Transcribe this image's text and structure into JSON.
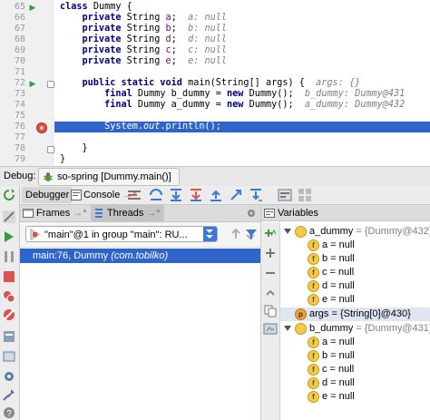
{
  "editor": {
    "lines": [
      {
        "num": "65",
        "parts": [
          {
            "t": "class ",
            "c": "kw"
          },
          {
            "t": "Dummy {",
            "c": ""
          }
        ]
      },
      {
        "num": "66",
        "parts": [
          {
            "t": "    private ",
            "c": "kw"
          },
          {
            "t": "String ",
            "c": ""
          },
          {
            "t": "a",
            "c": "fld"
          },
          {
            "t": ";  ",
            "c": ""
          },
          {
            "t": "a: null",
            "c": "hint"
          }
        ]
      },
      {
        "num": "67",
        "parts": [
          {
            "t": "    private ",
            "c": "kw"
          },
          {
            "t": "String ",
            "c": ""
          },
          {
            "t": "b",
            "c": "fld"
          },
          {
            "t": ";  ",
            "c": ""
          },
          {
            "t": "b: null",
            "c": "hint"
          }
        ]
      },
      {
        "num": "68",
        "parts": [
          {
            "t": "    private ",
            "c": "kw"
          },
          {
            "t": "String ",
            "c": ""
          },
          {
            "t": "d",
            "c": "fld"
          },
          {
            "t": ";  ",
            "c": ""
          },
          {
            "t": "d: null",
            "c": "hint"
          }
        ]
      },
      {
        "num": "69",
        "parts": [
          {
            "t": "    private ",
            "c": "kw"
          },
          {
            "t": "String ",
            "c": ""
          },
          {
            "t": "c",
            "c": "fld"
          },
          {
            "t": ";  ",
            "c": ""
          },
          {
            "t": "c: null",
            "c": "hint"
          }
        ]
      },
      {
        "num": "70",
        "parts": [
          {
            "t": "    private ",
            "c": "kw"
          },
          {
            "t": "String ",
            "c": ""
          },
          {
            "t": "e",
            "c": "fld"
          },
          {
            "t": ";  ",
            "c": ""
          },
          {
            "t": "e: null",
            "c": "hint"
          }
        ]
      },
      {
        "num": "71",
        "parts": []
      },
      {
        "num": "72",
        "parts": [
          {
            "t": "    public static void ",
            "c": "kw"
          },
          {
            "t": "main(String[] args) {  ",
            "c": ""
          },
          {
            "t": "args: {}",
            "c": "hint"
          }
        ]
      },
      {
        "num": "73",
        "parts": [
          {
            "t": "        final ",
            "c": "kw"
          },
          {
            "t": "Dummy b_dummy = ",
            "c": ""
          },
          {
            "t": "new ",
            "c": "kw"
          },
          {
            "t": "Dummy();  ",
            "c": ""
          },
          {
            "t": "b_dummy: Dummy@431",
            "c": "hint"
          }
        ]
      },
      {
        "num": "74",
        "parts": [
          {
            "t": "        final ",
            "c": "kw"
          },
          {
            "t": "Dummy a_dummy = ",
            "c": ""
          },
          {
            "t": "new ",
            "c": "kw"
          },
          {
            "t": "Dummy();  ",
            "c": ""
          },
          {
            "t": "a_dummy: Dummy@432",
            "c": "hint"
          }
        ]
      },
      {
        "num": "75",
        "parts": []
      },
      {
        "num": "76",
        "exec": true,
        "parts": [
          {
            "t": "        System.",
            "c": ""
          },
          {
            "t": "out",
            "c": "fld italic"
          },
          {
            "t": ".println();",
            "c": ""
          }
        ]
      },
      {
        "num": "77",
        "parts": []
      },
      {
        "num": "78",
        "parts": [
          {
            "t": "    }",
            "c": ""
          }
        ]
      },
      {
        "num": "79",
        "parts": [
          {
            "t": "}",
            "c": ""
          }
        ]
      }
    ]
  },
  "debug": {
    "label": "Debug:",
    "session_tab": "so-spring [Dummy.main()]"
  },
  "toolbar": {
    "debugger_tab": "Debugger",
    "console_tab": "Console",
    "console_suffix": "→*"
  },
  "frames": {
    "frames_tab": "Frames",
    "threads_tab": "Threads",
    "tab_suffix": "→*",
    "thread_selected": "\"main\"@1 in group \"main\": RU...",
    "frame_location": "main:76, Dummy",
    "frame_class": "(com.tobilko)"
  },
  "variables": {
    "title": "Variables",
    "a_dummy": {
      "name": "a_dummy",
      "value": " = {Dummy@432}"
    },
    "b_dummy": {
      "name": "b_dummy",
      "value": " = {Dummy@431}"
    },
    "args": {
      "name": "args",
      "value": " = {String[0]@430}"
    },
    "fields": [
      "a = null",
      "b = null",
      "c = null",
      "d = null",
      "e = null"
    ],
    "field_badge": "f",
    "param_badge": "p"
  },
  "colors": {
    "selection": "#2f65ca",
    "keyword": "#000080",
    "field": "#660e7a",
    "hint": "#808080"
  }
}
